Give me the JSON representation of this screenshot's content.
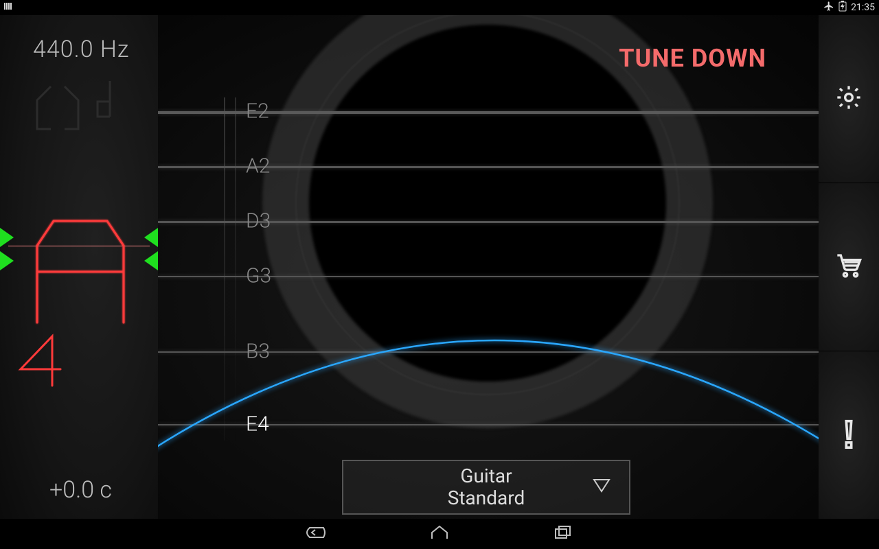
{
  "statusbar": {
    "time": "21:35"
  },
  "reference": {
    "freq_label": "440.0 Hz",
    "cents_label": "+0.0 c"
  },
  "detected": {
    "note": "A",
    "octave": "4"
  },
  "message": {
    "text": "TUNE DOWN",
    "color": "#f46b6b"
  },
  "strings": [
    {
      "label": "E2",
      "active": false
    },
    {
      "label": "A2",
      "active": false
    },
    {
      "label": "D3",
      "active": false
    },
    {
      "label": "G3",
      "active": false
    },
    {
      "label": "B3",
      "active": false
    },
    {
      "label": "E4",
      "active": true
    }
  ],
  "tuning": {
    "line1": "Guitar",
    "line2": "Standard"
  },
  "colors": {
    "accent_blue": "#2aa7ff",
    "accent_red": "#ff3a3a",
    "marker_green": "#1fdf1f"
  },
  "sidebar": {
    "items": [
      "settings",
      "store",
      "alert"
    ]
  }
}
